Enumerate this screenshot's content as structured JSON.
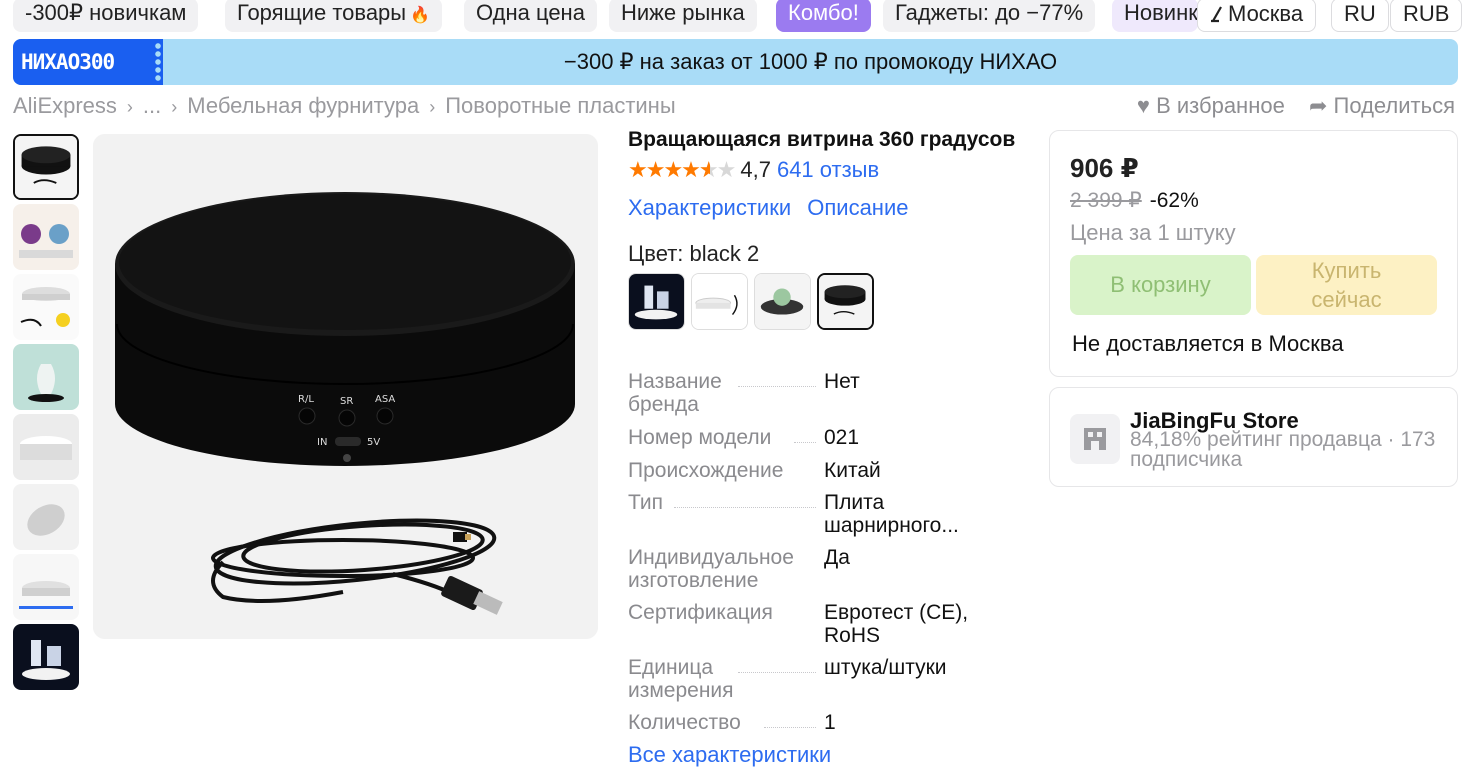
{
  "nav_chips": [
    {
      "label": "-300₽ новичкам"
    },
    {
      "label": "Горящие товары"
    },
    {
      "label": "Одна цена"
    },
    {
      "label": "Ниже рынка"
    },
    {
      "label": "Комбо!"
    },
    {
      "label": "Гаджеты: до −77%"
    },
    {
      "label": "Новинки"
    }
  ],
  "location": {
    "city": "Москва",
    "icon": "pin-icon"
  },
  "language": "RU",
  "currency": "RUB",
  "promo": {
    "code": "НИХАО300",
    "text": "−300 ₽ на заказ от 1000 ₽ по промокоду НИХАО"
  },
  "breadcrumb": [
    "AliExpress",
    "...",
    "Мебельная фурнитура",
    "Поворотные пластины"
  ],
  "actions": {
    "favorite": "В избранное",
    "share": "Поделиться"
  },
  "product": {
    "title": "Вращающаяся витрина 360 градусов",
    "rating": "4,7",
    "rating_value": 4.7,
    "reviews": "641 отзыв",
    "tabs": [
      "Характеристики",
      "Описание"
    ],
    "color_label": "Цвет: black 2",
    "properties": [
      {
        "key": "Название бренда",
        "value": "Нет"
      },
      {
        "key": "Номер модели",
        "value": "021"
      },
      {
        "key": "Происхождение",
        "value": "Китай"
      },
      {
        "key": "Тип",
        "value": "Плита шарнирного..."
      },
      {
        "key": "Индивидуальное изготовление",
        "value": "Да"
      },
      {
        "key": "Сертификация",
        "value": "Евротест (CE), RoHS"
      },
      {
        "key": "Единица измерения",
        "value": "штука/штуки"
      },
      {
        "key": "Количество",
        "value": "1"
      }
    ],
    "all_props": "Все характеристики",
    "image_labels": {
      "btn1": "R/L",
      "btn2": "SR",
      "btn3": "ASA",
      "port_in": "IN",
      "port_5v": "5V"
    }
  },
  "buy": {
    "price": "906 ₽",
    "old_price": "2 399 ₽",
    "discount": "-62%",
    "per_unit": "Цена за 1 штуку",
    "cart": "В корзину",
    "buy_now": "Купить сейчас",
    "delivery": "Не доставляется в Москва"
  },
  "store": {
    "name": "JiaBingFu Store",
    "meta": "84,18% рейтинг продавца · 173 подписчика"
  },
  "colors": {
    "accent": "#2d6cf0",
    "combo": "#9b7bf0",
    "promo_bg": "#a9dcf7",
    "promo_code_bg": "#1a5ff0",
    "star": "#ff7a00"
  }
}
